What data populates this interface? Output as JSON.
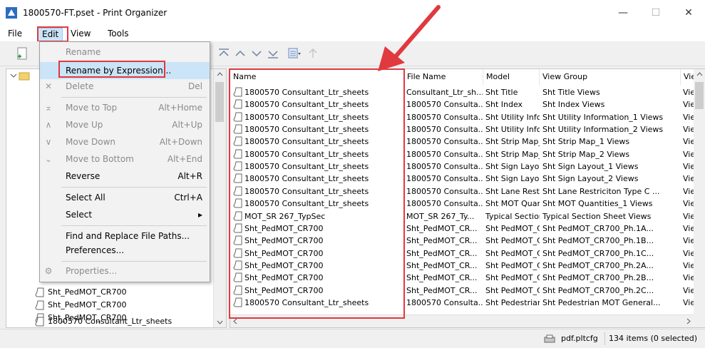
{
  "window": {
    "title": "1800570-FT.pset - Print Organizer",
    "minimize": "—",
    "maximize": "☐",
    "close": "✕"
  },
  "menubar": {
    "items": [
      "File",
      "Edit",
      "View",
      "Tools"
    ]
  },
  "edit_menu": {
    "rename": "Rename",
    "rename_by_expression": "Rename by Expression...",
    "delete": "Delete",
    "delete_shortcut": "Del",
    "move_to_top": "Move to Top",
    "move_to_top_shortcut": "Alt+Home",
    "move_up": "Move Up",
    "move_up_shortcut": "Alt+Up",
    "move_down": "Move Down",
    "move_down_shortcut": "Alt+Down",
    "move_to_bottom": "Move to Bottom",
    "move_to_bottom_shortcut": "Alt+End",
    "reverse": "Reverse",
    "reverse_shortcut": "Alt+R",
    "select_all": "Select All",
    "select_all_shortcut": "Ctrl+A",
    "select": "Select",
    "select_arrow": "▸",
    "find_replace": "Find and Replace File Paths...",
    "preferences": "Preferences...",
    "properties": "Properties..."
  },
  "tree": {
    "items": [
      "Sht_PedMOT_CR700",
      "Sht_PedMOT_CR700",
      "Sht_PedMOT_CR700",
      "1800570 Consultant_Ltr_sheets"
    ]
  },
  "table": {
    "headers": [
      "Name",
      "File Name",
      "Model",
      "View Group",
      "Vie"
    ],
    "rows": [
      [
        "1800570 Consultant_Ltr_sheets",
        "Consultant_Ltr_sh...",
        "Sht Title",
        "Sht Title Views",
        "Viev"
      ],
      [
        "1800570 Consultant_Ltr_sheets",
        "1800570 Consulta...",
        "Sht Index",
        "Sht Index Views",
        "Viev"
      ],
      [
        "1800570 Consultant_Ltr_sheets",
        "1800570 Consulta...",
        "Sht Utility Inform...",
        "Sht Utility Information_1 Views",
        "Viev"
      ],
      [
        "1800570 Consultant_Ltr_sheets",
        "1800570 Consulta...",
        "Sht Utility Inform...",
        "Sht Utility Information_2 Views",
        "Viev"
      ],
      [
        "1800570 Consultant_Ltr_sheets",
        "1800570 Consulta...",
        "Sht Strip Map_1",
        "Sht Strip Map_1 Views",
        "Viev"
      ],
      [
        "1800570 Consultant_Ltr_sheets",
        "1800570 Consulta...",
        "Sht Strip Map_2",
        "Sht Strip Map_2 Views",
        "Viev"
      ],
      [
        "1800570 Consultant_Ltr_sheets",
        "1800570 Consulta...",
        "Sht Sign Layout...",
        "Sht Sign Layout_1 Views",
        "Viev"
      ],
      [
        "1800570 Consultant_Ltr_sheets",
        "1800570 Consulta...",
        "Sht Sign Layout...",
        "Sht Sign Layout_2 Views",
        "Viev"
      ],
      [
        "1800570 Consultant_Ltr_sheets",
        "1800570 Consulta...",
        "Sht Lane Restri...",
        "Sht Lane Restriciton Type C ...",
        "Viev"
      ],
      [
        "1800570 Consultant_Ltr_sheets",
        "1800570 Consulta...",
        "Sht MOT Quanti...",
        "Sht MOT Quantities_1 Views",
        "Viev"
      ],
      [
        "MOT_SR 267_TypSec",
        "MOT_SR 267_Ty...",
        "Typical Section ...",
        "Typical Section Sheet Views",
        "Viev"
      ],
      [
        "Sht_PedMOT_CR700",
        "Sht_PedMOT_CR...",
        "Sht PedMOT_C...",
        "Sht PedMOT_CR700_Ph.1A...",
        "Viev"
      ],
      [
        "Sht_PedMOT_CR700",
        "Sht_PedMOT_CR...",
        "Sht PedMOT_C...",
        "Sht PedMOT_CR700_Ph.1B...",
        "Viev"
      ],
      [
        "Sht_PedMOT_CR700",
        "Sht_PedMOT_CR...",
        "Sht PedMOT_C...",
        "Sht PedMOT_CR700_Ph.1C...",
        "Viev"
      ],
      [
        "Sht_PedMOT_CR700",
        "Sht_PedMOT_CR...",
        "Sht PedMOT_C...",
        "Sht PedMOT_CR700_Ph.2A...",
        "Viev"
      ],
      [
        "Sht_PedMOT_CR700",
        "Sht_PedMOT_CR...",
        "Sht PedMOT_C...",
        "Sht PedMOT_CR700_Ph.2B...",
        "Viev"
      ],
      [
        "Sht_PedMOT_CR700",
        "Sht_PedMOT_CR...",
        "Sht PedMOT_C...",
        "Sht PedMOT_CR700_Ph.2C...",
        "Viev"
      ],
      [
        "1800570 Consultant_Ltr_sheets",
        "1800570 Consulta...",
        "Sht Pedestrian ...",
        "Sht Pedestrian MOT General...",
        "Viev"
      ]
    ]
  },
  "status": {
    "config": "pdf.pltcfg",
    "items": "134 items (0 selected)"
  },
  "colors": {
    "highlight": "#e0393e",
    "accent": "#cce4f7"
  }
}
